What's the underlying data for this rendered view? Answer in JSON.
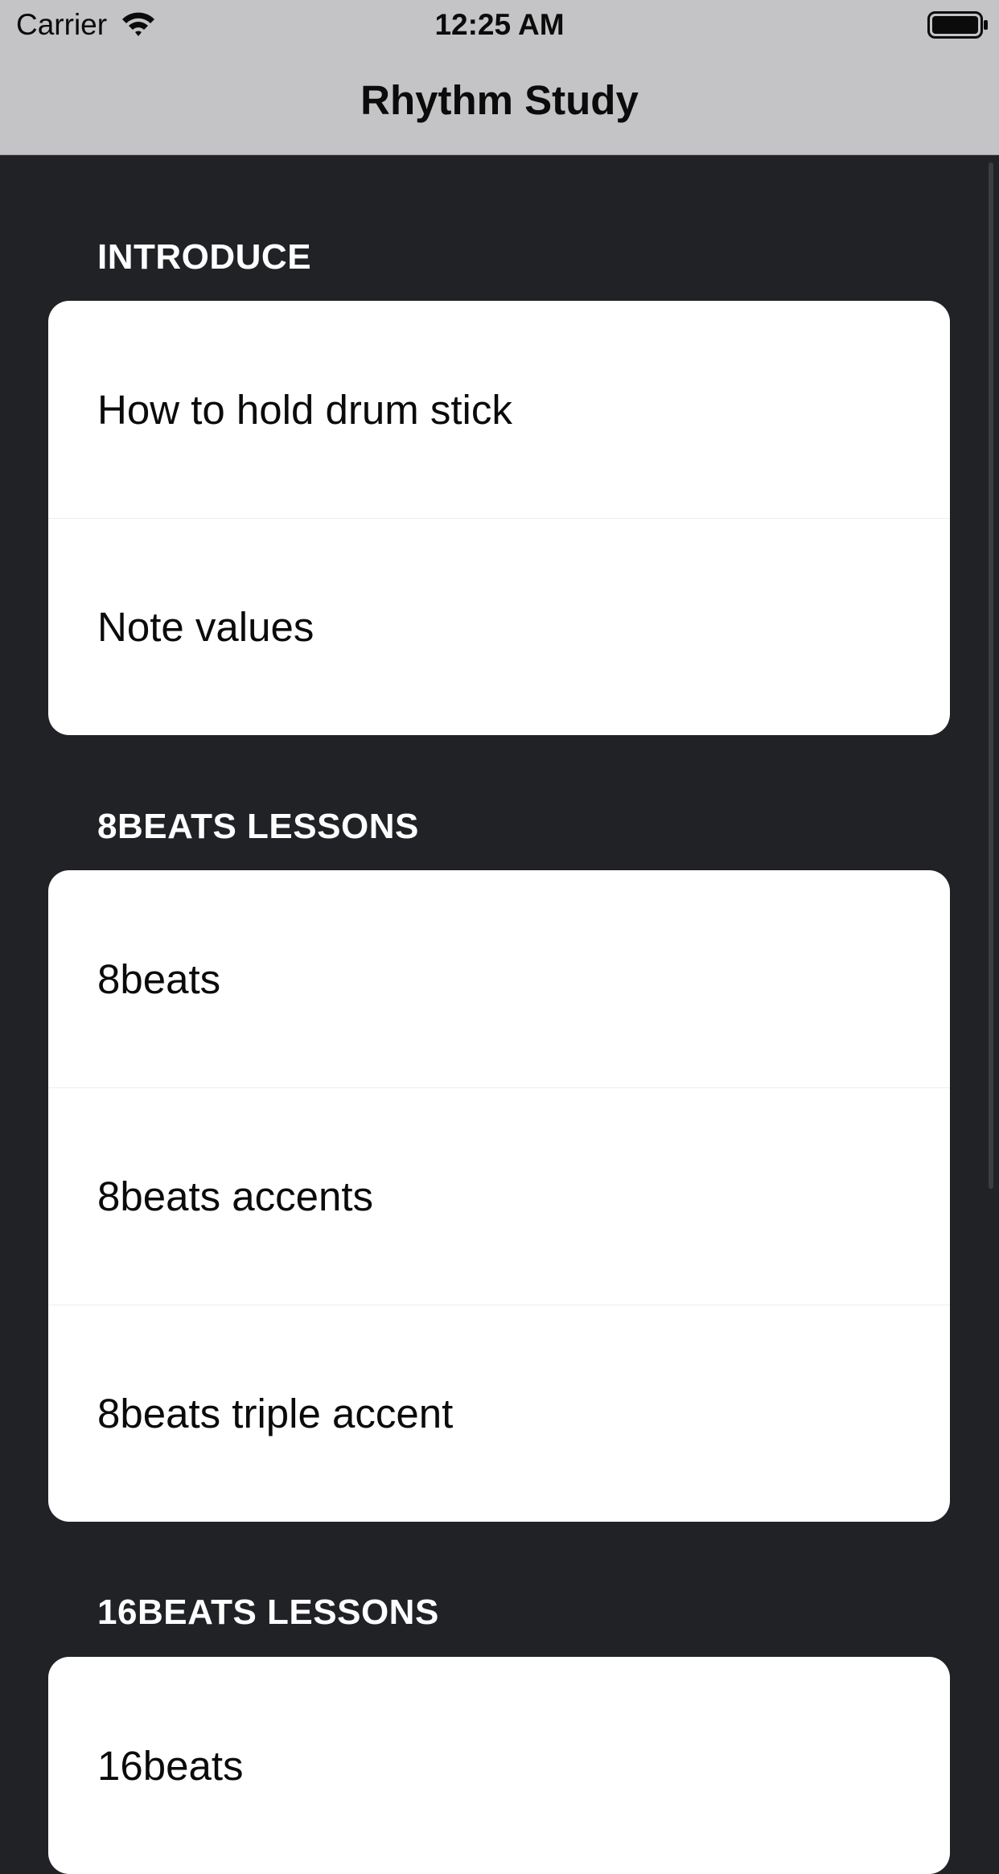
{
  "status_bar": {
    "carrier": "Carrier",
    "time": "12:25 AM",
    "wifi_icon": "wifi-icon",
    "battery_icon": "battery-full-icon"
  },
  "nav": {
    "title": "Rhythm Study"
  },
  "sections": [
    {
      "header": "INTRODUCE",
      "items": [
        "How to hold drum stick",
        "Note values"
      ]
    },
    {
      "header": "8BEATS LESSONS",
      "items": [
        "8beats",
        "8beats accents",
        "8beats triple accent"
      ]
    },
    {
      "header": "16BEATS LESSONS",
      "items": [
        "16beats"
      ]
    }
  ],
  "colors": {
    "background": "#212226",
    "bar": "#c4c4c6",
    "cell": "#ffffff",
    "text": "#0b0b0b",
    "header_text": "#ffffff"
  }
}
